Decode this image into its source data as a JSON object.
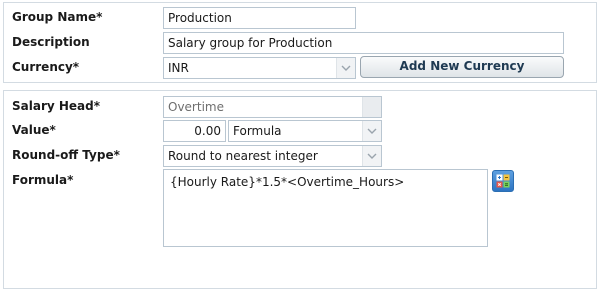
{
  "group": {
    "name_label": "Group Name*",
    "name_value": "Production",
    "description_label": "Description",
    "description_value": "Salary group for Production",
    "currency_label": "Currency*",
    "currency_value": "INR",
    "add_currency_button": "Add New Currency"
  },
  "salary_head": {
    "head_label": "Salary Head*",
    "head_value": "Overtime",
    "value_label": "Value*",
    "value_amount": "0.00",
    "value_type": "Formula",
    "roundoff_label": "Round-off Type*",
    "roundoff_value": "Round to nearest integer",
    "formula_label": "Formula*",
    "formula_value": "{Hourly Rate}*1.5*<Overtime_Hours>",
    "formula_builder_icon": "calculator-icon"
  },
  "colors": {
    "border": "#d3dbe2",
    "field_border": "#b9c6d1",
    "icon_blue": "#2d74c2"
  }
}
